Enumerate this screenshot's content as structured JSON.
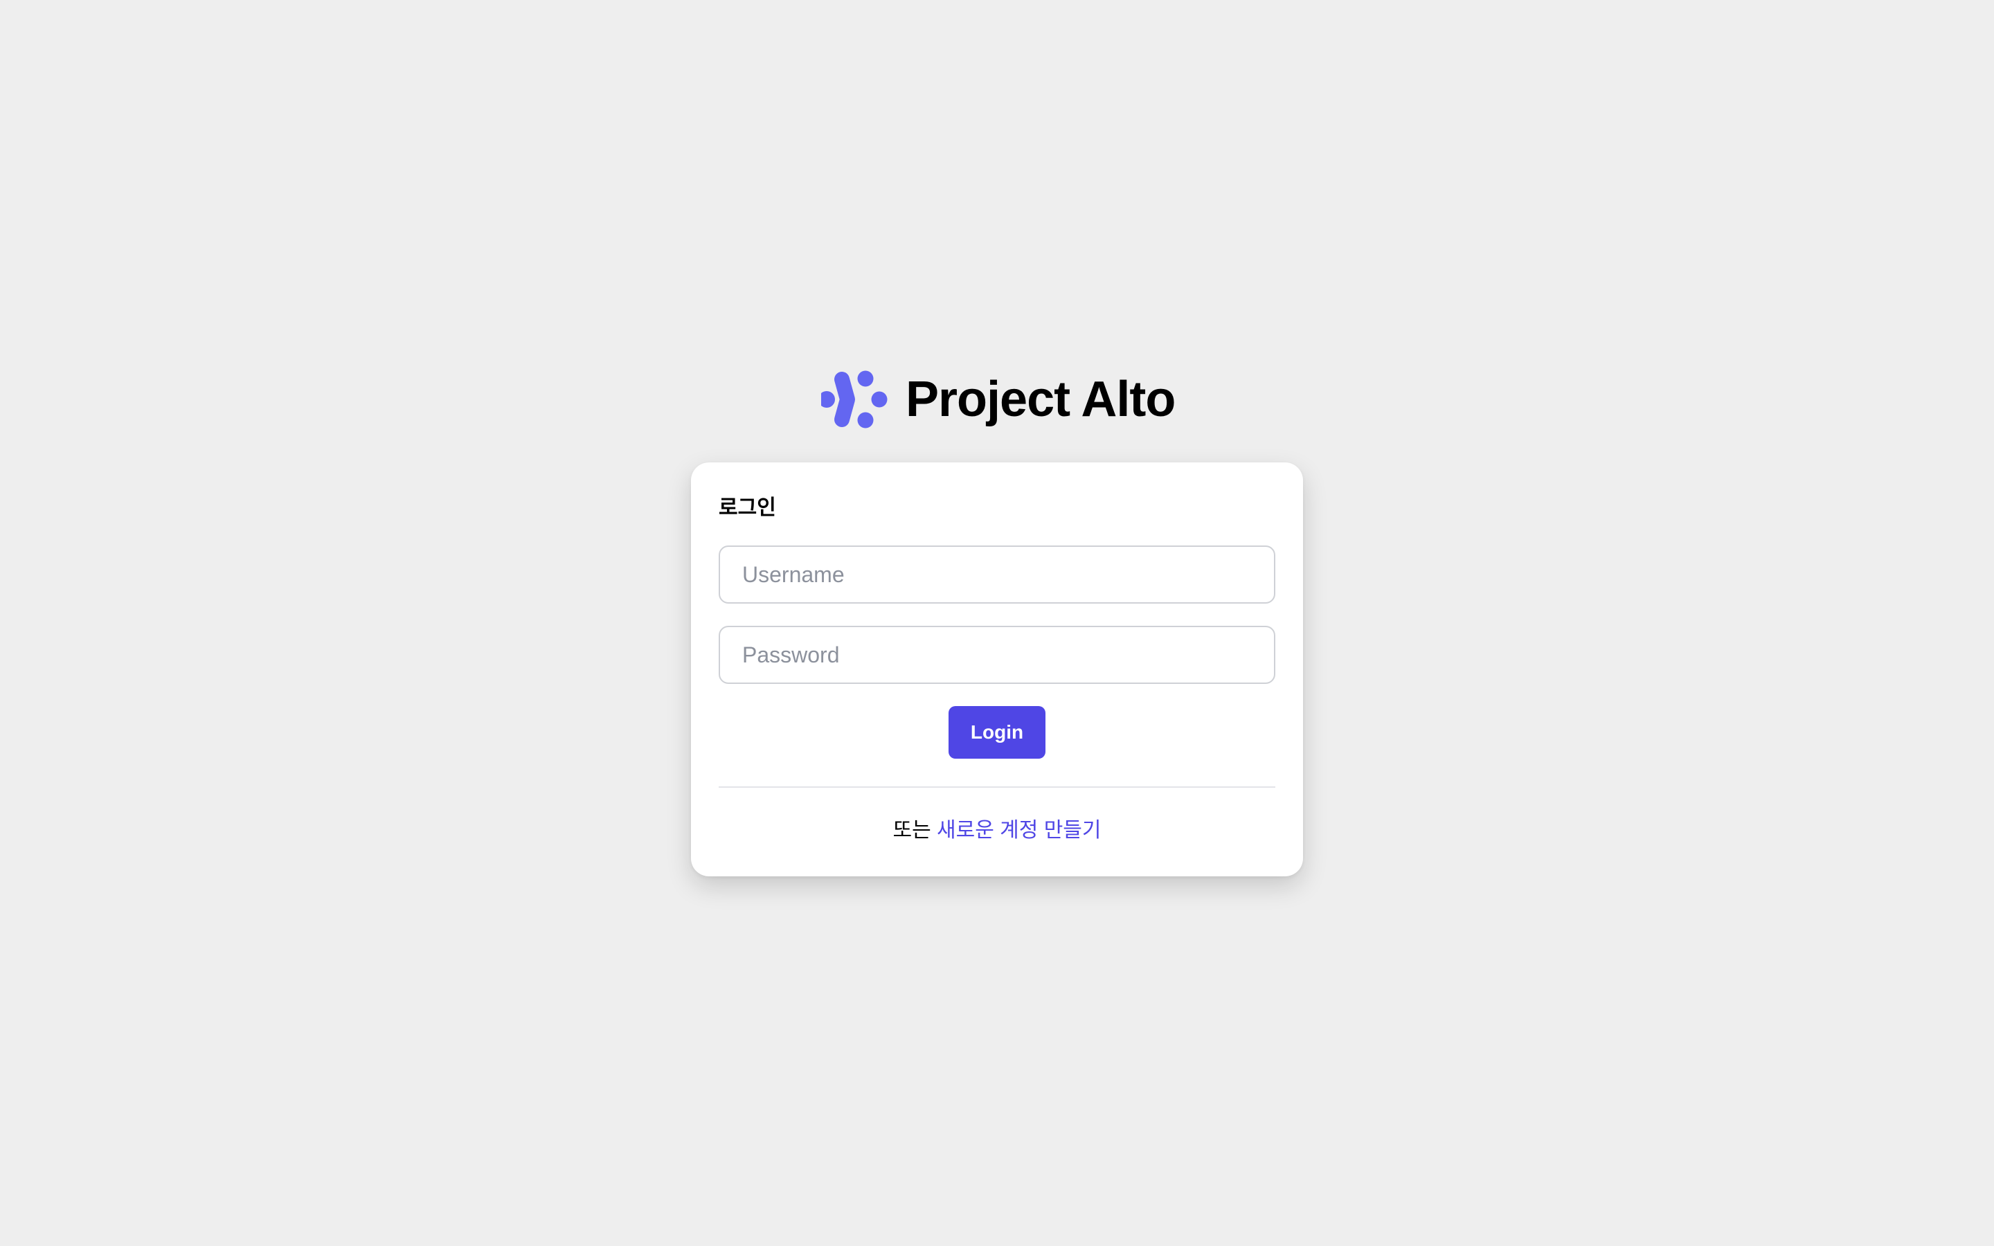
{
  "brand": {
    "name": "Project Alto",
    "logo_icon": "project-alto-logo-icon",
    "logo_color": "#6366f1"
  },
  "login": {
    "title": "로그인",
    "username_placeholder": "Username",
    "password_placeholder": "Password",
    "submit_label": "Login",
    "alternative_prefix": "또는 ",
    "signup_link_label": "새로운 계정 만들기"
  },
  "colors": {
    "background": "#eeeeee",
    "card": "#ffffff",
    "accent": "#4f46e5",
    "placeholder_text": "#8c919c",
    "input_border": "#cfd1d6"
  }
}
